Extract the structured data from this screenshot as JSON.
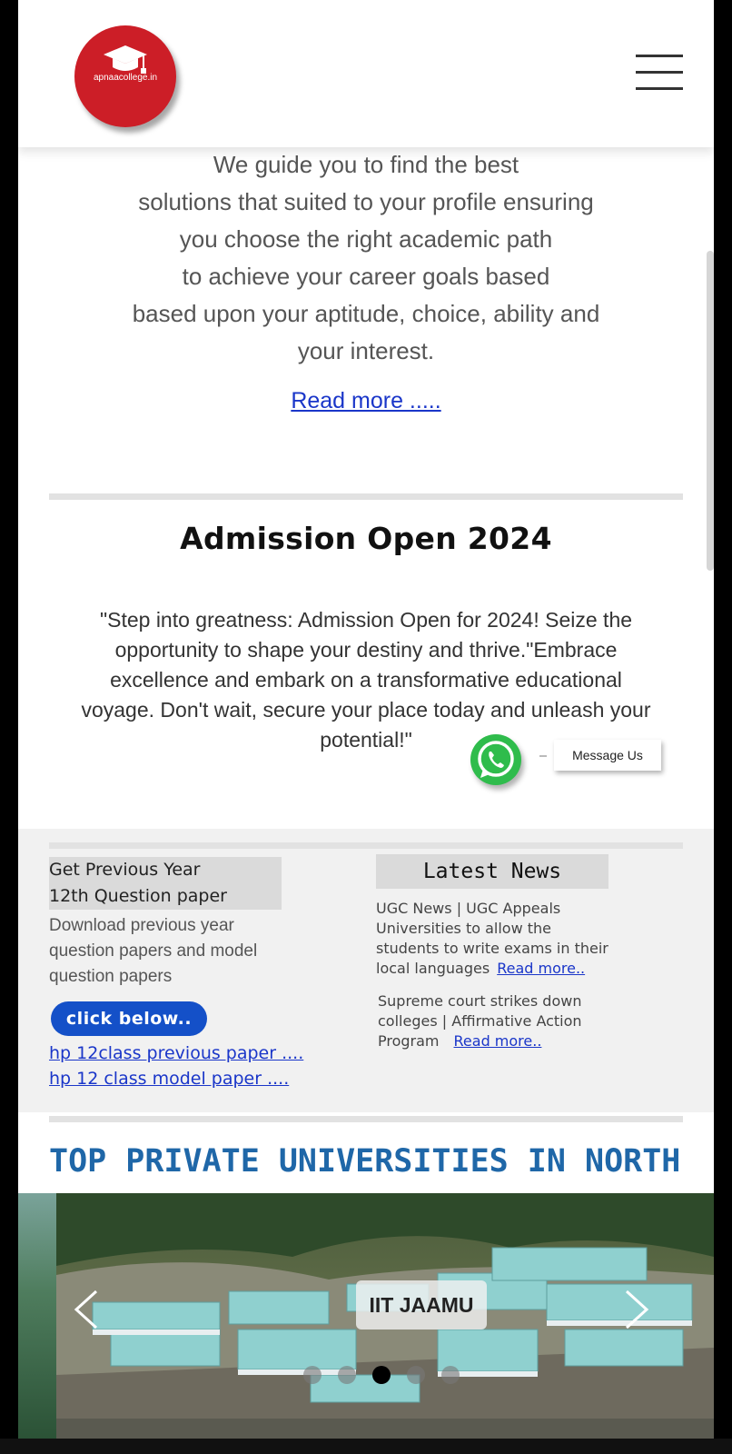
{
  "header": {
    "logo_text": "apnaacollege.in"
  },
  "intro": {
    "lines": [
      "We guide you to find the best",
      "solutions that suited to your profile ensuring",
      "you choose the right academic path",
      "to achieve your career goals based",
      "based upon your aptitude, choice, ability and",
      "your interest."
    ],
    "read_more": "Read more ....."
  },
  "admission": {
    "title": "Admission Open 2024",
    "lines": [
      "\"Step into greatness: Admission Open for 2024! Seize the",
      "opportunity to shape your destiny and thrive.\"Embrace",
      "excellence and embark on a transformative educational",
      "voyage. Don't wait, secure your place today and unleash your",
      "potential!\""
    ]
  },
  "whatsapp": {
    "label": "Message Us",
    "color": "#2fbc4c"
  },
  "previous_papers": {
    "title_lines": [
      "Get Previous Year",
      "12th Question paper"
    ],
    "desc_lines": [
      "Download previous year",
      "question papers and model",
      "question papers"
    ],
    "button_label": "click below..",
    "links": [
      "hp 12class previous paper ....",
      "hp 12 class model paper ...."
    ]
  },
  "latest_news": {
    "title": "Latest News",
    "items": [
      {
        "lines": [
          "UGC News | UGC Appeals",
          "Universities to allow the",
          "students to write exams in their",
          "local languages"
        ],
        "link": "Read more.."
      },
      {
        "lines": [
          "Supreme  court strikes down",
          "colleges | Affirmative Action",
          "Program"
        ],
        "link": "Read more.."
      }
    ]
  },
  "universities": {
    "title": "TOP PRIVATE UNIVERSITIES IN NORTH",
    "carousel": {
      "caption": "IIT JAAMU",
      "dot_count": 5,
      "active_dot": 3
    }
  },
  "colors": {
    "link": "#1a36c9",
    "button": "#1450c8",
    "logo": "#cc1e27",
    "section_title": "#1f67a8"
  }
}
